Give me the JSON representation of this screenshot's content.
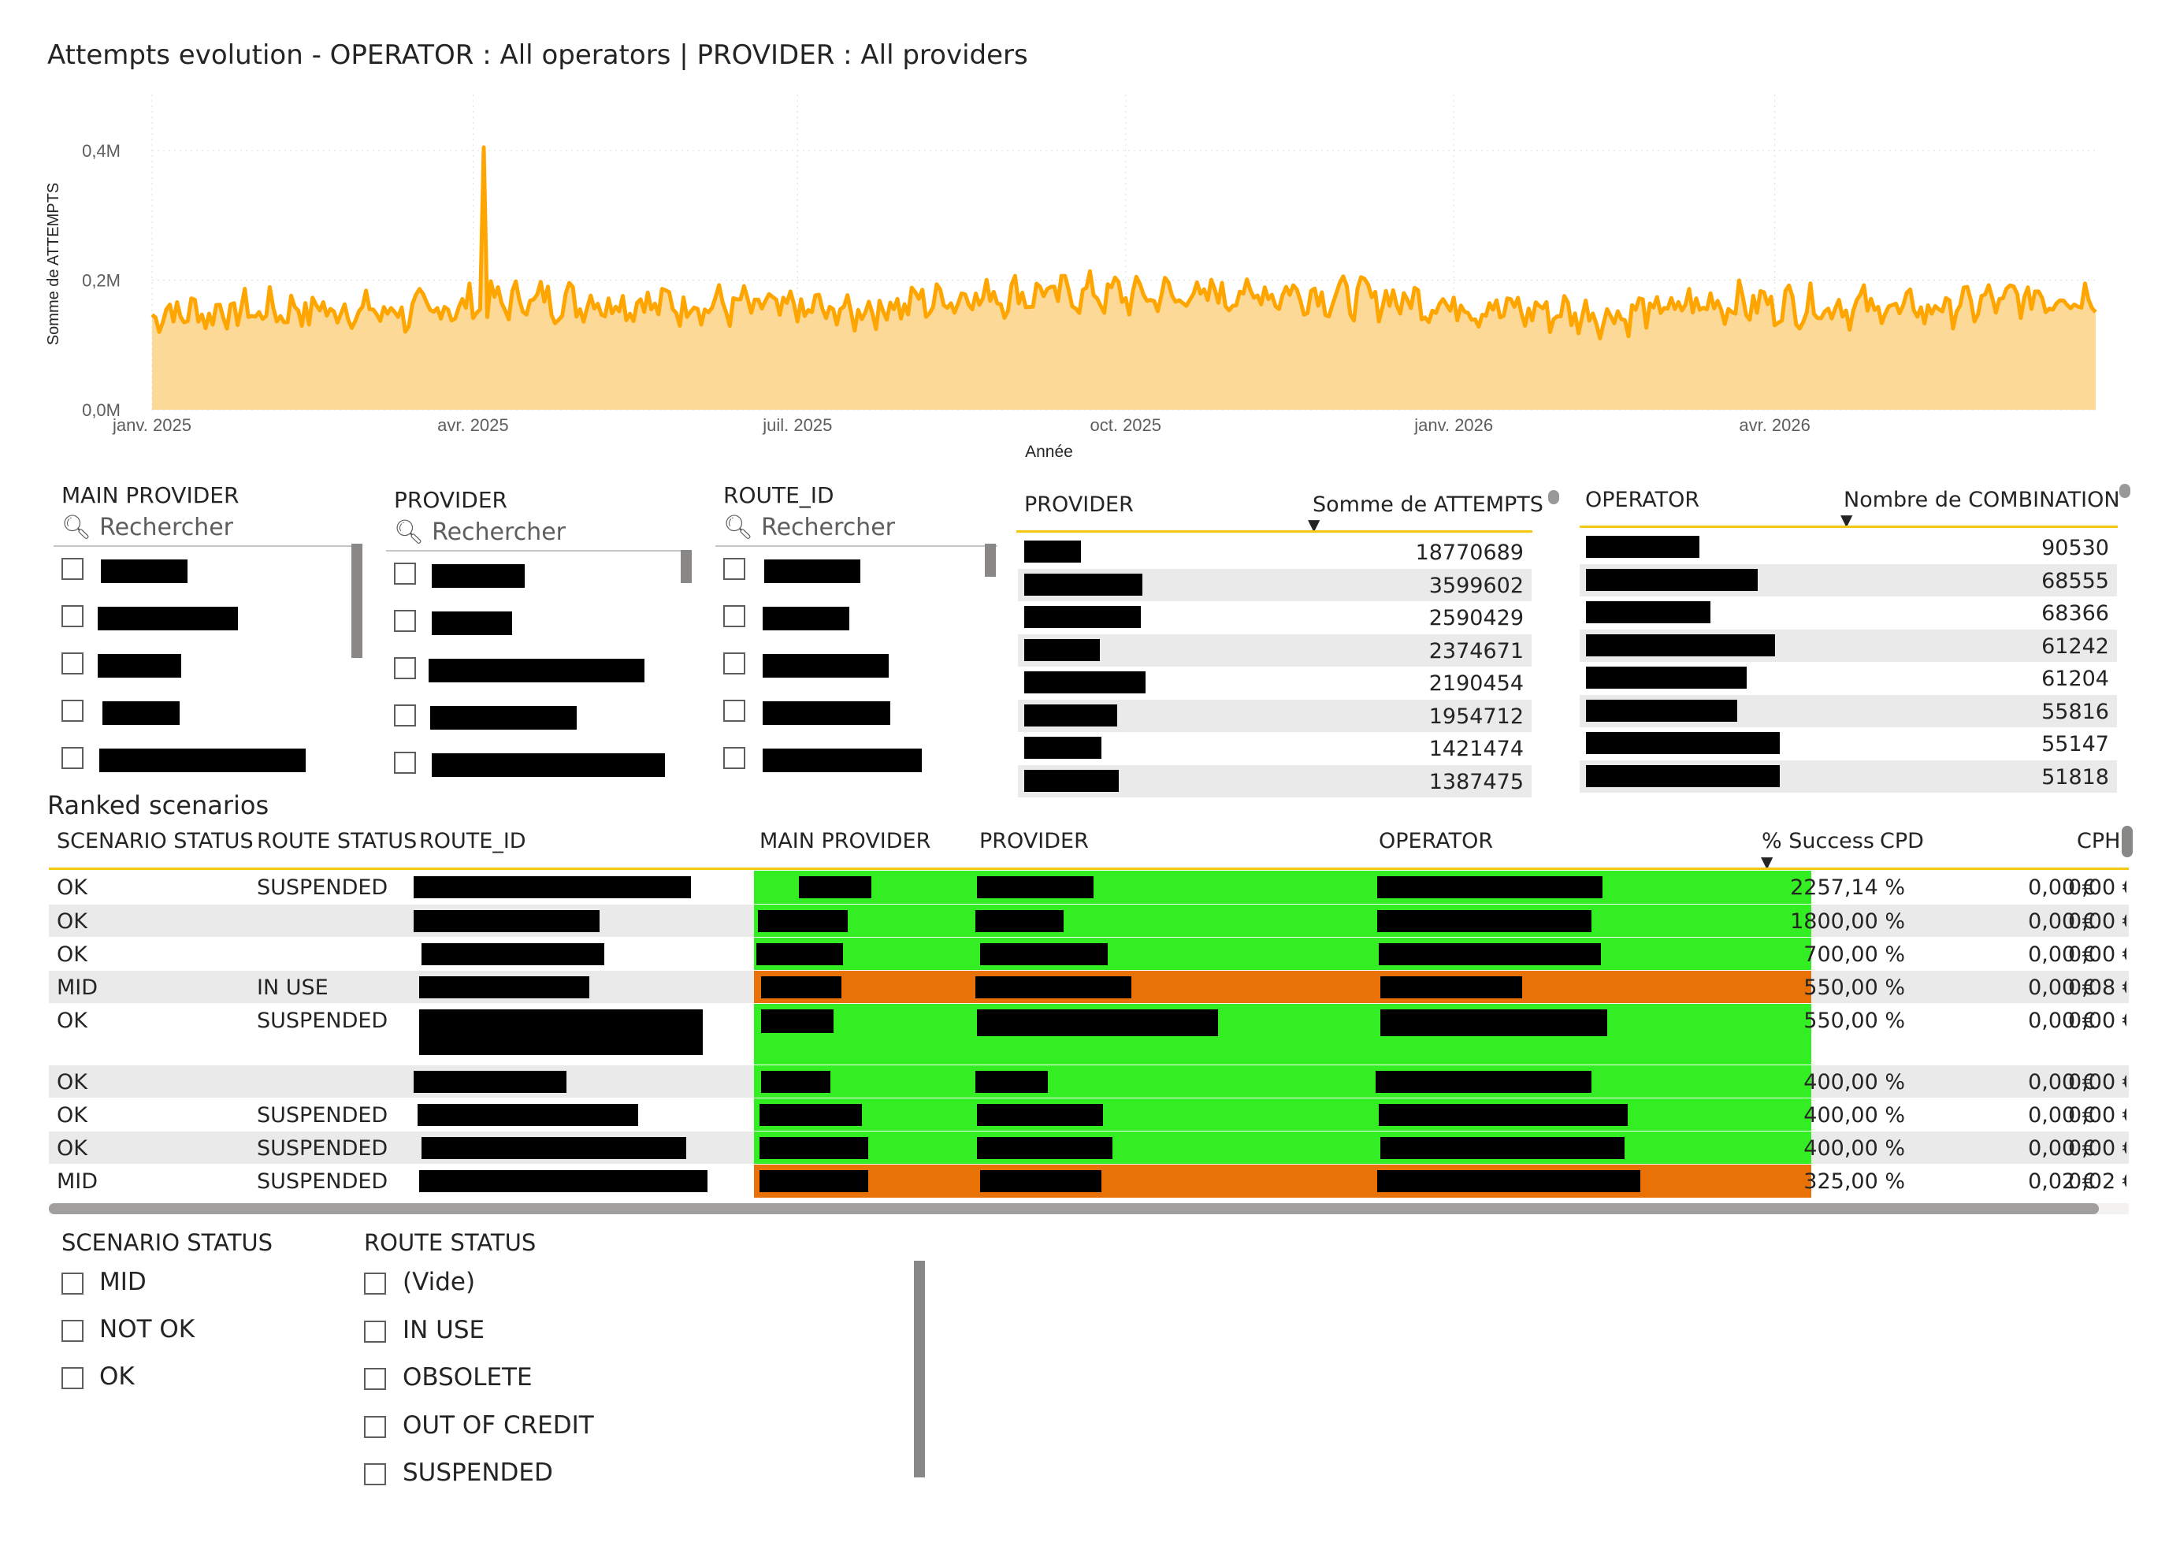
{
  "chart": {
    "title": "Attempts evolution - OPERATOR : All operators | PROVIDER : All providers"
  },
  "chart_data": {
    "type": "area",
    "title": "Attempts evolution - OPERATOR : All operators | PROVIDER : All providers",
    "xlabel": "Année",
    "ylabel": "Somme de ATTEMPTS",
    "ytick_labels": [
      "0,0M",
      "0,2M",
      "0,4M"
    ],
    "ylim": [
      0,
      450000
    ],
    "xtick_labels": [
      "janv. 2025",
      "avr. 2025",
      "juil. 2025",
      "oct. 2025",
      "janv. 2026",
      "avr. 2026"
    ],
    "x_range": [
      "2025-01-01",
      "2026-06-30"
    ],
    "grid": true,
    "color": "#FFA500",
    "fill_color": "#FCD997",
    "series": [
      {
        "x": [
          "2025-01",
          "2025-02",
          "2025-03",
          "2025-04",
          "2025-05",
          "2025-06",
          "2025-07",
          "2025-08",
          "2025-09",
          "2025-10",
          "2025-11",
          "2025-12",
          "2026-01",
          "2026-02",
          "2026-03",
          "2026-04",
          "2026-05",
          "2026-06"
        ],
        "values": [
          150000,
          155000,
          150000,
          170000,
          165000,
          160000,
          150000,
          175000,
          180000,
          175000,
          180000,
          170000,
          155000,
          145000,
          165000,
          160000,
          155000,
          175000
        ]
      }
    ],
    "peak": {
      "x": "2025-04-04",
      "value": 405000
    }
  },
  "slicers": [
    {
      "title": "MAIN PROVIDER",
      "placeholder": "Rechercher"
    },
    {
      "title": "PROVIDER",
      "placeholder": "Rechercher"
    },
    {
      "title": "ROUTE_ID",
      "placeholder": "Rechercher"
    }
  ],
  "provider_table": {
    "col1": "PROVIDER",
    "col2": "Somme de ATTEMPTS",
    "values": [
      "18770689",
      "3599602",
      "2590429",
      "2374671",
      "2190454",
      "1954712",
      "1421474",
      "1387475"
    ]
  },
  "operator_table": {
    "col1": "OPERATOR",
    "col2": "Nombre de COMBINATION",
    "values": [
      "90530",
      "68555",
      "68366",
      "61242",
      "61204",
      "55816",
      "55147",
      "51818"
    ]
  },
  "ranked": {
    "title": "Ranked scenarios",
    "headers": [
      "SCENARIO STATUS",
      "ROUTE STATUS",
      "ROUTE_ID",
      "MAIN PROVIDER",
      "PROVIDER",
      "OPERATOR",
      "% Success",
      "CPD",
      "CPH"
    ],
    "rows": [
      {
        "scenario": "OK",
        "route": "SUSPENDED",
        "success": "2257,14 %",
        "cpd": "0,00 €",
        "cph": "0,00 €",
        "color": "green"
      },
      {
        "scenario": "OK",
        "route": "",
        "success": "1800,00 %",
        "cpd": "0,00 €",
        "cph": "0,00 €",
        "color": "green"
      },
      {
        "scenario": "OK",
        "route": "",
        "success": "700,00 %",
        "cpd": "0,00 €",
        "cph": "0,00 €",
        "color": "green"
      },
      {
        "scenario": "MID",
        "route": "IN USE",
        "success": "550,00 %",
        "cpd": "0,00 €",
        "cph": "0,08 €",
        "color": "orange"
      },
      {
        "scenario": "OK",
        "route": "SUSPENDED",
        "success": "550,00 %",
        "cpd": "0,00 €",
        "cph": "0,00 €",
        "color": "green"
      },
      {
        "scenario": "OK",
        "route": "",
        "success": "400,00 %",
        "cpd": "0,00 €",
        "cph": "0,00 €",
        "color": "green"
      },
      {
        "scenario": "OK",
        "route": "SUSPENDED",
        "success": "400,00 %",
        "cpd": "0,00 €",
        "cph": "0,00 €",
        "color": "green"
      },
      {
        "scenario": "OK",
        "route": "SUSPENDED",
        "success": "400,00 %",
        "cpd": "0,00 €",
        "cph": "0,00 €",
        "color": "green"
      },
      {
        "scenario": "MID",
        "route": "SUSPENDED",
        "success": "325,00 %",
        "cpd": "0,02 €",
        "cph": "0,02 €",
        "color": "orange"
      }
    ]
  },
  "scenario_status": {
    "title": "SCENARIO STATUS",
    "options": [
      "MID",
      "NOT OK",
      "OK"
    ]
  },
  "route_status": {
    "title": "ROUTE STATUS",
    "options": [
      "(Vide)",
      "IN USE",
      "OBSOLETE",
      "OUT OF CREDIT",
      "SUSPENDED"
    ]
  }
}
